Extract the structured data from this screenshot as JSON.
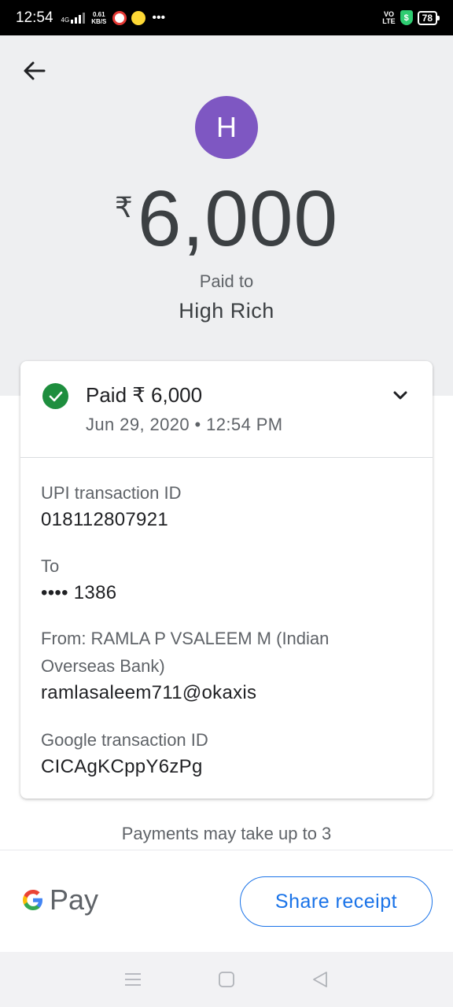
{
  "status_bar": {
    "time": "12:54",
    "network": "4G",
    "speed_value": "0.61",
    "speed_unit": "KB/S",
    "volte_top": "VO",
    "volte_bottom": "LTE",
    "shield": "$",
    "battery": "78"
  },
  "header": {
    "avatar_letter": "H",
    "currency": "₹",
    "amount": "6,000",
    "paid_to_label": "Paid to",
    "payee_name": "High Rich"
  },
  "card": {
    "status": "Paid ₹ 6,000",
    "datetime": "Jun 29, 2020 • 12:54 PM",
    "details": [
      {
        "label": "UPI transaction ID",
        "value": "018112807921"
      },
      {
        "label": "To",
        "value": "•••• 1386"
      },
      {
        "label": "From: RAMLA P VSALEEM M (Indian Overseas Bank)",
        "value": "ramlasaleem711@okaxis"
      },
      {
        "label": "Google transaction ID",
        "value": "CICAgKCppY6zPg"
      }
    ]
  },
  "notice": "Payments may take up to 3",
  "bottom": {
    "gpay_label": "Pay",
    "share_label": "Share receipt"
  },
  "colors": {
    "accent": "#1a73e8",
    "success": "#1e8e3e",
    "avatar": "#7e57c2",
    "header_bg": "#eeeff1"
  },
  "icons": [
    "back-arrow-icon",
    "check-circle-icon",
    "chevron-down-icon",
    "google-g-icon",
    "menu-icon",
    "home-icon",
    "back-triangle-icon"
  ]
}
